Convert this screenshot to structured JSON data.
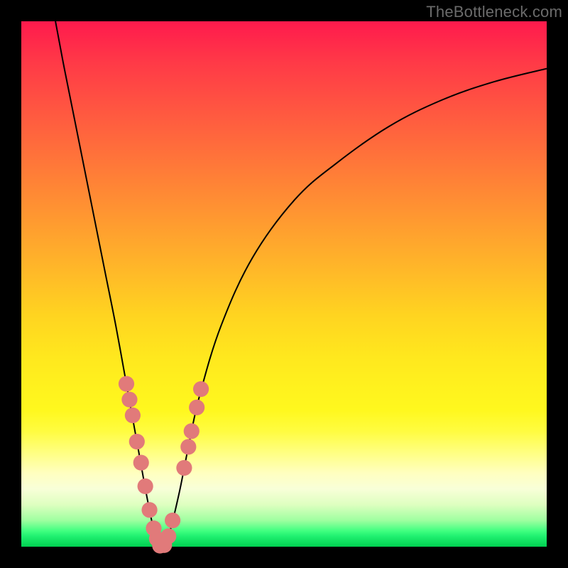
{
  "watermark": "TheBottleneck.com",
  "colors": {
    "background": "#000000",
    "curve_stroke": "#000000",
    "marker_fill": "#e17a7a",
    "gradient_top": "#ff1a4d",
    "gradient_bottom": "#00d050"
  },
  "chart_data": {
    "type": "line",
    "title": "",
    "xlabel": "",
    "ylabel": "",
    "xlim": [
      0,
      100
    ],
    "ylim": [
      0,
      100
    ],
    "note": "Bottleneck-style V curve; minimum near x≈26. y = 100 means top (red/bad), y = 0 means bottom (green/good).",
    "curve_left": [
      {
        "x": 6.5,
        "y": 100
      },
      {
        "x": 8,
        "y": 92
      },
      {
        "x": 10,
        "y": 82
      },
      {
        "x": 12,
        "y": 72
      },
      {
        "x": 14,
        "y": 62
      },
      {
        "x": 16,
        "y": 52
      },
      {
        "x": 18,
        "y": 42
      },
      {
        "x": 20,
        "y": 31
      },
      {
        "x": 22,
        "y": 20
      },
      {
        "x": 24,
        "y": 9
      },
      {
        "x": 25.5,
        "y": 2
      },
      {
        "x": 26.5,
        "y": 0
      }
    ],
    "curve_right": [
      {
        "x": 26.5,
        "y": 0
      },
      {
        "x": 28,
        "y": 2
      },
      {
        "x": 30,
        "y": 10
      },
      {
        "x": 32,
        "y": 20
      },
      {
        "x": 34,
        "y": 29
      },
      {
        "x": 38,
        "y": 42
      },
      {
        "x": 44,
        "y": 55
      },
      {
        "x": 52,
        "y": 66
      },
      {
        "x": 60,
        "y": 73
      },
      {
        "x": 70,
        "y": 80
      },
      {
        "x": 80,
        "y": 85
      },
      {
        "x": 90,
        "y": 88.5
      },
      {
        "x": 100,
        "y": 91
      }
    ],
    "markers": [
      {
        "x": 20.0,
        "y": 31.0
      },
      {
        "x": 20.6,
        "y": 28.0
      },
      {
        "x": 21.2,
        "y": 25.0
      },
      {
        "x": 22.0,
        "y": 20.0
      },
      {
        "x": 22.8,
        "y": 16.0
      },
      {
        "x": 23.6,
        "y": 11.5
      },
      {
        "x": 24.4,
        "y": 7.0
      },
      {
        "x": 25.2,
        "y": 3.5
      },
      {
        "x": 25.8,
        "y": 1.5
      },
      {
        "x": 26.4,
        "y": 0.2
      },
      {
        "x": 27.2,
        "y": 0.3
      },
      {
        "x": 28.0,
        "y": 2.0
      },
      {
        "x": 28.8,
        "y": 5.0
      },
      {
        "x": 31.0,
        "y": 15.0
      },
      {
        "x": 31.8,
        "y": 19.0
      },
      {
        "x": 32.4,
        "y": 22.0
      },
      {
        "x": 33.4,
        "y": 26.5
      },
      {
        "x": 34.2,
        "y": 30.0
      }
    ],
    "marker_radius": 1.5
  }
}
